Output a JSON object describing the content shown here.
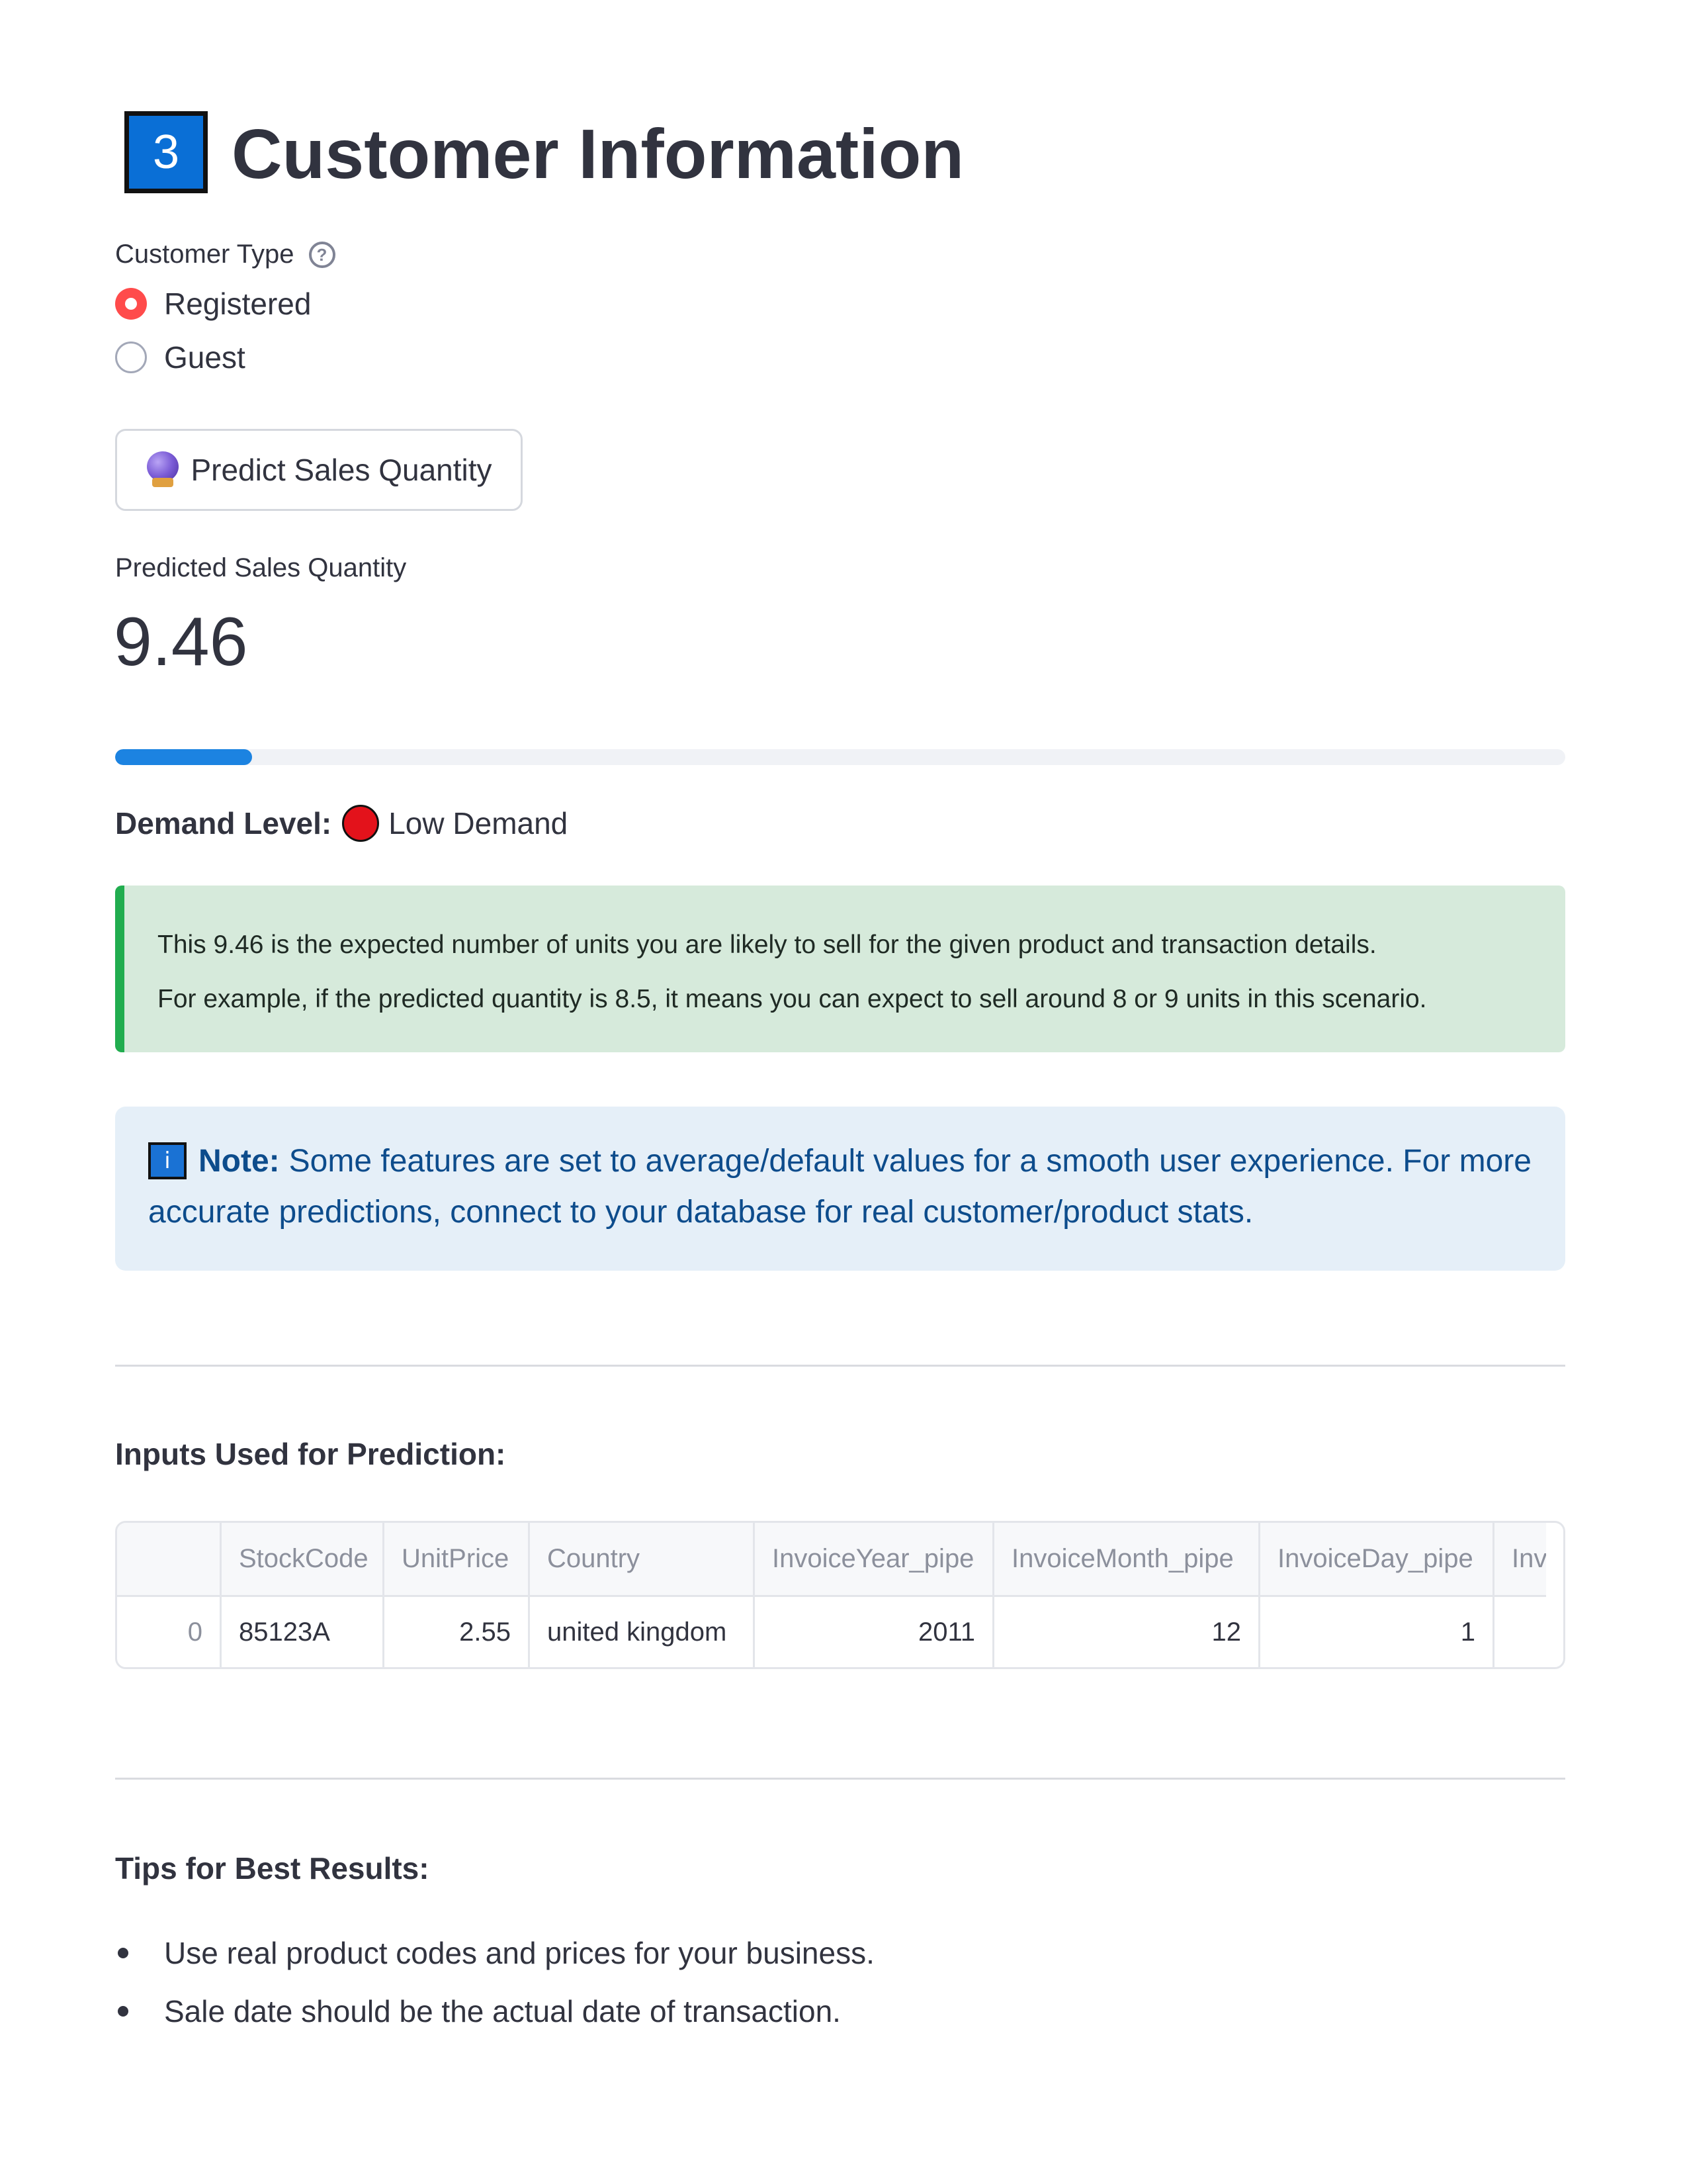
{
  "section": {
    "number": "3",
    "title": "Customer Information"
  },
  "customer_type": {
    "label": "Customer Type",
    "help_icon": "question-circle-icon",
    "options": [
      {
        "label": "Registered",
        "selected": true
      },
      {
        "label": "Guest",
        "selected": false
      }
    ]
  },
  "predict_button": {
    "icon": "crystal-ball-icon",
    "label": "Predict Sales Quantity"
  },
  "metric": {
    "label": "Predicted Sales Quantity",
    "value": "9.46"
  },
  "progress": {
    "fraction": 0.0946,
    "color": "#1c83e1"
  },
  "demand": {
    "label": "Demand Level:",
    "icon": "red-circle-icon",
    "value": "Low Demand"
  },
  "success_message": {
    "line1": "This 9.46 is the expected number of units you are likely to sell for the given product and transaction details.",
    "line2": "For example, if the predicted quantity is 8.5, it means you can expect to sell around 8 or 9 units in this scenario."
  },
  "info_message": {
    "icon": "info-icon",
    "bold": "Note:",
    "line1": "Some features are set to average/default values for a smooth user experience. For more",
    "line2": "accurate predictions, connect to your database for real customer/product stats."
  },
  "inputs_section": {
    "heading": "Inputs Used for Prediction:"
  },
  "table": {
    "columns": [
      "",
      "StockCode",
      "UnitPrice",
      "Country",
      "InvoiceYear_pipe",
      "InvoiceMonth_pipe",
      "InvoiceDay_pipe",
      "Inv"
    ],
    "rows": [
      [
        "0",
        "85123A",
        "2.55",
        "united kingdom",
        "2011",
        "12",
        "1",
        ""
      ]
    ]
  },
  "tips_section": {
    "heading": "Tips for Best Results:",
    "items": [
      "Use real product codes and prices for your business.",
      "Sale date should be the actual date of transaction."
    ]
  },
  "colors": {
    "accent_red": "#ff4b4b",
    "progress_blue": "#1c83e1",
    "success_bg": "#d6eadb",
    "success_border": "#21ad4f",
    "info_bg": "#e5eff8",
    "info_text": "#0d4c8c"
  }
}
